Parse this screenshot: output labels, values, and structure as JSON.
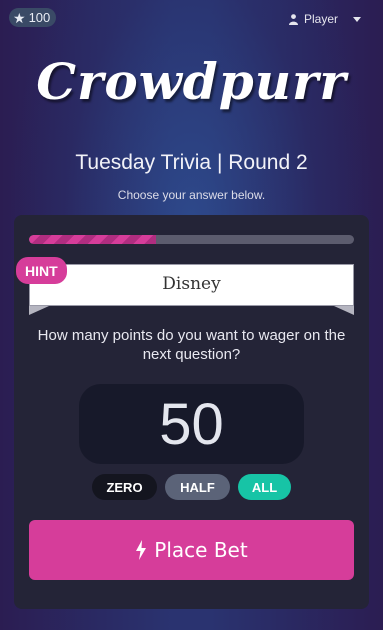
{
  "header": {
    "score": "100",
    "score_icon": "star-icon",
    "user_label": "Player",
    "user_icon": "person-icon"
  },
  "branding": {
    "logo_text": "Crowdpurr"
  },
  "game": {
    "title": "Tuesday Trivia | Round 2",
    "instruction": "Choose your answer below."
  },
  "card": {
    "progress": 0.39,
    "hint_tag": "HINT",
    "hint_word": "Disney",
    "question": "How many points do you want to wager on the next question?",
    "wager_amount": "50",
    "chips": {
      "zero": "ZERO",
      "half": "HALF",
      "all": "ALL"
    },
    "place_bet_label": "Place Bet",
    "place_bet_icon": "bolt-icon"
  },
  "colors": {
    "accent_pink": "#d63d9a",
    "accent_teal": "#17c4a6",
    "card_bg": "#242437"
  }
}
